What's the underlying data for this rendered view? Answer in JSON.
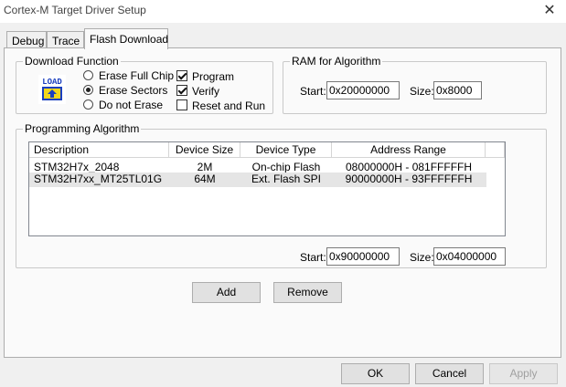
{
  "window": {
    "title": "Cortex-M Target Driver Setup",
    "close_glyph": "✕"
  },
  "tabs": [
    {
      "label": "Debug",
      "active": false
    },
    {
      "label": "Trace",
      "active": false
    },
    {
      "label": "Flash Download",
      "active": true
    }
  ],
  "download_function": {
    "group_label": "Download Function",
    "icon_text": "LOAD",
    "radios": [
      {
        "label": "Erase Full Chip",
        "selected": false
      },
      {
        "label": "Erase Sectors",
        "selected": true
      },
      {
        "label": "Do not Erase",
        "selected": false
      }
    ],
    "checks": [
      {
        "label": "Program",
        "checked": true
      },
      {
        "label": "Verify",
        "checked": true
      },
      {
        "label": "Reset and Run",
        "checked": false
      }
    ]
  },
  "ram": {
    "group_label": "RAM for Algorithm",
    "start_label": "Start:",
    "start_value": "0x20000000",
    "size_label": "Size:",
    "size_value": "0x8000"
  },
  "algorithm": {
    "group_label": "Programming Algorithm",
    "columns": [
      "Description",
      "Device Size",
      "Device Type",
      "Address Range"
    ],
    "rows": [
      {
        "description": "STM32H7x_2048",
        "size": "2M",
        "type": "On-chip Flash",
        "range": "08000000H - 081FFFFFH"
      },
      {
        "description": "STM32H7xx_MT25TL01G",
        "size": "64M",
        "type": "Ext. Flash SPI",
        "range": "90000000H - 93FFFFFFH"
      }
    ],
    "start_label": "Start:",
    "start_value": "0x90000000",
    "size_label": "Size:",
    "size_value": "0x04000000",
    "add_label": "Add",
    "remove_label": "Remove"
  },
  "footer": {
    "ok_label": "OK",
    "cancel_label": "Cancel",
    "apply_label": "Apply"
  },
  "colors": {
    "panel": "#fafafa",
    "dialog": "#f0f0f0",
    "selected_row": "#e5e5e5",
    "icon_blue": "#1a3fbf",
    "icon_yellow": "#f2d71b"
  }
}
